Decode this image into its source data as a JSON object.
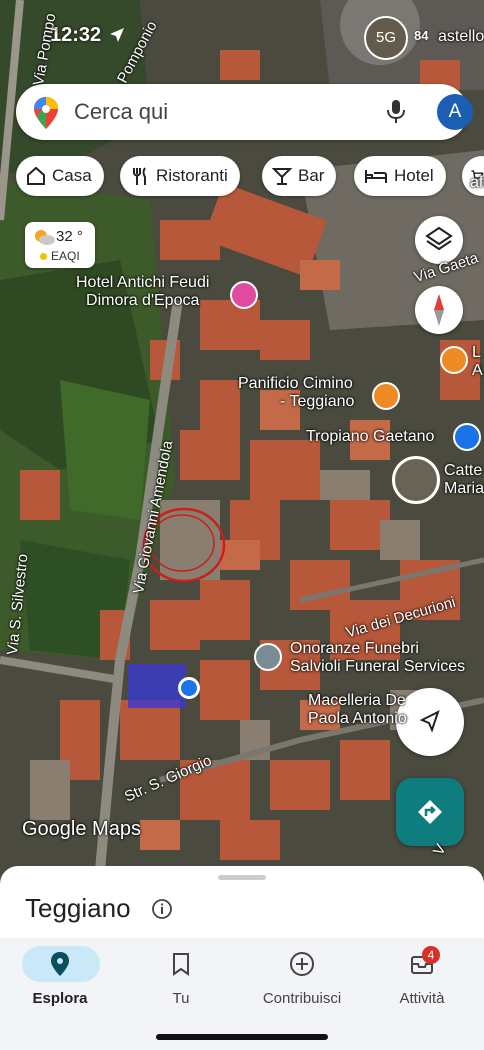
{
  "status_bar": {
    "time": "12:32",
    "network": "5G",
    "battery": "84"
  },
  "search": {
    "placeholder": "Cerca qui",
    "avatar_letter": "A"
  },
  "chips": [
    {
      "label": "Casa",
      "icon": "home-icon"
    },
    {
      "label": "Ristoranti",
      "icon": "fork-knife-icon"
    },
    {
      "label": "Bar",
      "icon": "cocktail-icon"
    },
    {
      "label": "Hotel",
      "icon": "bed-icon"
    },
    {
      "label": "",
      "icon": "cart-icon"
    }
  ],
  "weather": {
    "temp": "32 °",
    "aqi": "EAQI"
  },
  "map_labels": {
    "hotel": [
      "Hotel Antichi Feudi",
      "Dimora d'Epoca"
    ],
    "panificio": [
      "Panificio Cimino",
      "- Teggiano"
    ],
    "tropiano": "Tropiano Gaetano",
    "cattedrale": [
      "Catte",
      "Maria"
    ],
    "onoranze": [
      "Onoranze Funebri",
      "Salvioli Funeral Services"
    ],
    "macelleria": [
      "Macelleria De",
      "Paola Antonio"
    ],
    "castello": "astello",
    "right_edge": [
      "L",
      "A"
    ],
    "cafe": "afi"
  },
  "streets": {
    "pompo": "Via Pompo",
    "pomponio": "Pomponio",
    "amendola": "Via Giovanni Amendola",
    "silvestro": "Via S. Silvestro",
    "decurioni": "Via dei Decurioni",
    "giorgio": "Str. S. Giorgio",
    "gaeta": "Via Gaeta",
    "via_edge": "V"
  },
  "watermark": "Google Maps",
  "sheet": {
    "title": "Teggiano"
  },
  "bottom_nav": [
    {
      "label": "Esplora",
      "icon": "location-pin-icon",
      "active": true
    },
    {
      "label": "Tu",
      "icon": "bookmark-icon",
      "active": false
    },
    {
      "label": "Contribuisci",
      "icon": "add-circle-icon",
      "active": false
    },
    {
      "label": "Attività",
      "icon": "inbox-icon",
      "active": false,
      "badge": "4"
    }
  ],
  "colors": {
    "accent": "#1a73e8",
    "directions_fab": "#0f7c7e",
    "badge": "#d93025",
    "active_pill": "#c9e8f8"
  }
}
